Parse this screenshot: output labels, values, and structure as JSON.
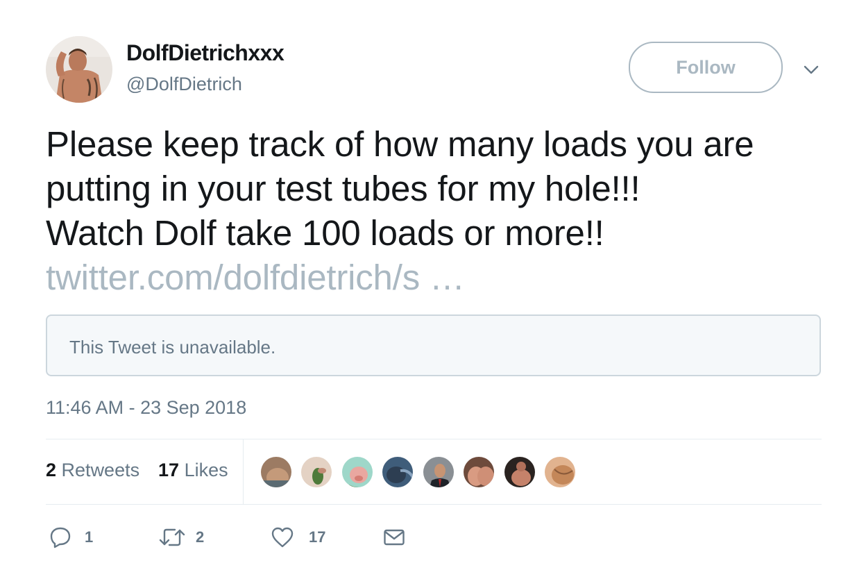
{
  "user": {
    "display_name": "DolfDietrichxxx",
    "handle": "@DolfDietrich"
  },
  "follow_label": "Follow",
  "tweet": {
    "lines": [
      "Please keep track of how many loads you are",
      "putting in your test tubes for my hole!!!",
      "Watch Dolf take 100 loads or more!!"
    ],
    "link": "twitter.com/dolfdietrich/s …"
  },
  "quote": {
    "text": "This Tweet is unavailable."
  },
  "timestamp": "11:46 AM - 23 Sep 2018",
  "stats": {
    "retweets_count": "2",
    "retweets_label": "Retweets",
    "likes_count": "17",
    "likes_label": "Likes"
  },
  "likers": [
    "liker-1",
    "liker-2",
    "liker-3",
    "liker-4",
    "liker-5",
    "liker-6",
    "liker-7",
    "liker-8"
  ],
  "actions": {
    "reply_count": "1",
    "retweet_count": "2",
    "like_count": "17"
  },
  "colors": {
    "text": "#14171a",
    "secondary": "#657786",
    "muted": "#aab8c2",
    "border": "#e6ecf0",
    "quote_bg": "#f5f8fa"
  },
  "icons": [
    "avatar",
    "chevron-down-icon",
    "reply-icon",
    "retweet-icon",
    "heart-icon",
    "message-icon"
  ]
}
